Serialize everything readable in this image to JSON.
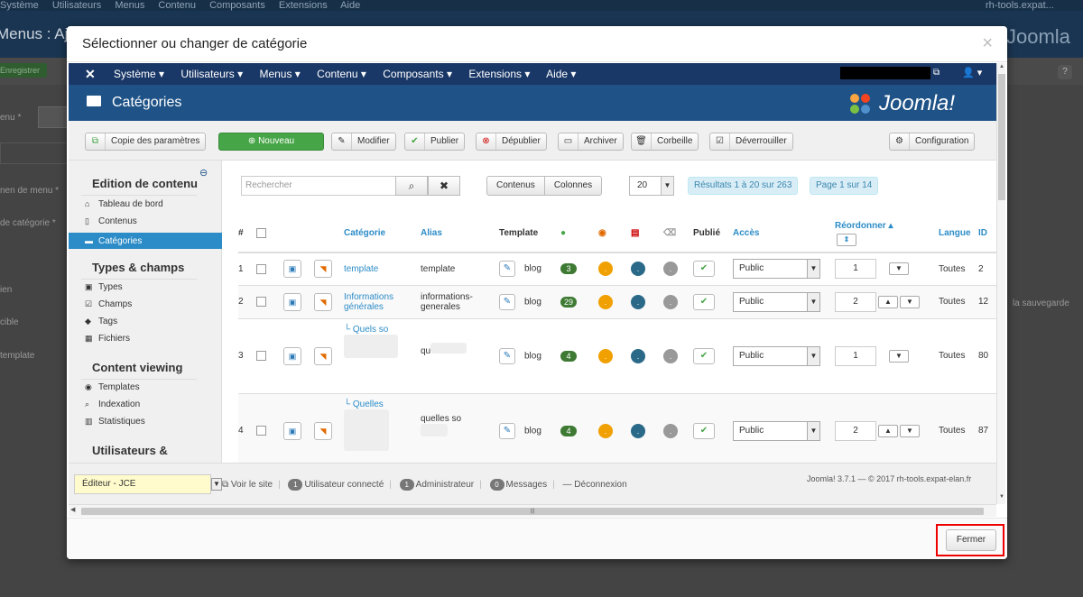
{
  "background": {
    "topbar": [
      "Système",
      "Utilisateurs",
      "Menus",
      "Contenu",
      "Composants",
      "Extensions",
      "Aide"
    ],
    "site": "rh-tools.expat...",
    "title": "Menus : Aj",
    "logo": "Joomla",
    "save": "Enregistrer",
    "help": "?",
    "labels": [
      "enu *",
      "nen de menu *",
      "de catégorie *",
      "ien",
      "cible",
      "template",
      "la sauvegarde"
    ]
  },
  "modal": {
    "title": "Sélectionner ou changer de catégorie",
    "close_icon": "×",
    "close_label": "Fermer"
  },
  "nav": {
    "items": [
      "Système ▾",
      "Utilisateurs ▾",
      "Menus ▾",
      "Contenu ▾",
      "Composants ▾",
      "Extensions ▾",
      "Aide ▾"
    ],
    "user": "👤 ▾"
  },
  "header": {
    "title": "Catégories",
    "logo": "Joomla!"
  },
  "toolbar": {
    "copy": "Copie des paramètres",
    "new": "Nouveau",
    "edit": "Modifier",
    "publish": "Publier",
    "unpublish": "Dépublier",
    "archive": "Archiver",
    "trash": "Corbeille",
    "unlock": "Déverrouiller",
    "config": "Configuration"
  },
  "sidebar": {
    "sections": [
      {
        "title": "Edition de contenu",
        "items": [
          "Tableau de bord",
          "Contenus",
          "Catégories"
        ]
      },
      {
        "title": "Types & champs",
        "items": [
          "Types",
          "Champs",
          "Tags",
          "Fichiers"
        ]
      },
      {
        "title": "Content viewing",
        "items": [
          "Templates",
          "Indexation",
          "Statistiques"
        ]
      },
      {
        "title": "Utilisateurs &",
        "items": []
      }
    ]
  },
  "filters": {
    "search_placeholder": "Rechercher",
    "contents": "Contenus",
    "columns": "Colonnes",
    "limit": "20",
    "results": "Résultats 1 à 20 sur 263",
    "page": "Page 1 sur 14"
  },
  "table": {
    "headers": {
      "num": "#",
      "category": "Catégorie",
      "alias": "Alias",
      "template": "Template",
      "published": "Publié",
      "access": "Accès",
      "reorder": "Réordonner ▴",
      "language": "Langue",
      "id": "ID"
    },
    "rows": [
      {
        "num": "1",
        "category": "template",
        "alias": "template",
        "tpl": "blog",
        "count": "3",
        "access": "Public",
        "order": "1",
        "lang": "Toutes",
        "id": "2"
      },
      {
        "num": "2",
        "category": "Informations générales",
        "alias": "informations-generales",
        "tpl": "blog",
        "count": "29",
        "access": "Public",
        "order": "2",
        "lang": "Toutes",
        "id": "12"
      },
      {
        "num": "3",
        "category": "└ Quels so",
        "alias": "qu",
        "tpl": "blog",
        "count": "4",
        "access": "Public",
        "order": "1",
        "lang": "Toutes",
        "id": "80"
      },
      {
        "num": "4",
        "category": "└ Quelles",
        "alias": "quelles so",
        "tpl": "blog",
        "count": "4",
        "access": "Public",
        "order": "2",
        "lang": "Toutes",
        "id": "87"
      }
    ]
  },
  "statusbar": {
    "editor": "Éditeur - JCE",
    "view_site": "Voir le site",
    "users_count": "1",
    "users_label": "Utilisateur connecté",
    "admin_count": "1",
    "admin_label": "Administrateur",
    "msg_count": "0",
    "msg_label": "Messages",
    "logout": "Déconnexion",
    "copyright": "Joomla! 3.7.1 — © 2017 rh-tools.expat-elan.fr"
  },
  "colors": {
    "nav": "#1a3867",
    "header": "#1f5286",
    "accent": "#2c8cc7",
    "green": "#46a546",
    "highlight": "#e00000"
  }
}
